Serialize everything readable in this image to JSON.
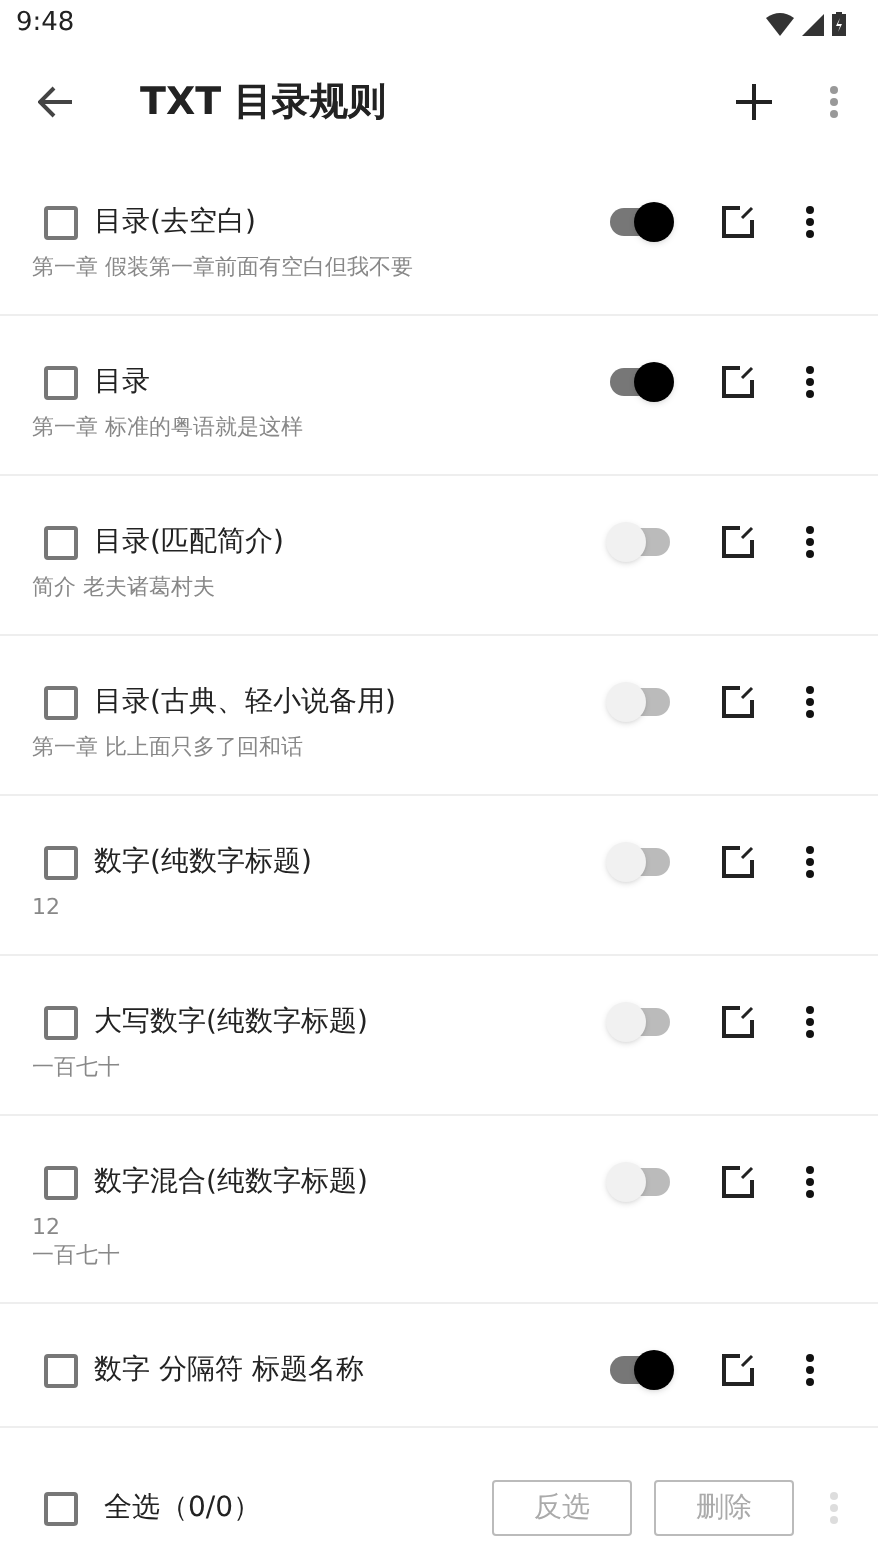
{
  "status_bar": {
    "time": "9:48"
  },
  "toolbar": {
    "title": "TXT 目录规则"
  },
  "rules": [
    {
      "name": "目录(去空白)",
      "example": "第一章 假装第一章前面有空白但我不要",
      "checked": false,
      "on": true
    },
    {
      "name": "目录",
      "example": "第一章 标准的粤语就是这样",
      "checked": false,
      "on": true
    },
    {
      "name": "目录(匹配简介)",
      "example": "简介 老夫诸葛村夫",
      "checked": false,
      "on": false
    },
    {
      "name": "目录(古典、轻小说备用)",
      "example": "第一章 比上面只多了回和话",
      "checked": false,
      "on": false
    },
    {
      "name": "数字(纯数字标题)",
      "example": "12",
      "checked": false,
      "on": false
    },
    {
      "name": "大写数字(纯数字标题)",
      "example": "一百七十",
      "checked": false,
      "on": false
    },
    {
      "name": "数字混合(纯数字标题)",
      "example": "12\n一百七十",
      "checked": false,
      "on": false
    },
    {
      "name": "数字 分隔符 标题名称",
      "checked": false,
      "on": true
    }
  ],
  "bottom_bar": {
    "select_all": "全选（0/0）",
    "select_all_checked": false,
    "invert": "反选",
    "delete": "删除"
  }
}
